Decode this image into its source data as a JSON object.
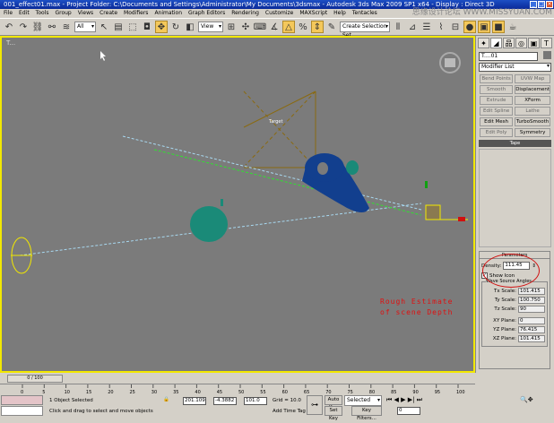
{
  "title": "001_effect01.max    -    Project Folder: C:\\Documents and Settings\\Administrator\\My Documents\\3dsmax    -    Autodesk 3ds Max  2009 SP1  x64    -    Display : Direct 3D",
  "watermark": "思缘设计论坛 WWW.MISSYUAN.COM",
  "menu": [
    "File",
    "Edit",
    "Tools",
    "Group",
    "Views",
    "Create",
    "Modifiers",
    "Animation",
    "Graph Editors",
    "Rendering",
    "Customize",
    "MAXScript",
    "Help",
    "Tentacles"
  ],
  "toolbar": {
    "selection_filter": "All",
    "reference_coord": "View",
    "named_selection": "Create Selection Set"
  },
  "viewport": {
    "label": "T...",
    "annotation_line1": "Rough Estimate",
    "annotation_line2": "of scene Depth",
    "target_label": "Target",
    "colors": {
      "background": "#7b7b7b",
      "border": "#f2e800",
      "annotation": "#e01010",
      "mesh": "#123f8e",
      "teapot": "#1a8a78"
    }
  },
  "command_panel": {
    "tabs": [
      "create",
      "modify",
      "hierarchy",
      "motion",
      "display",
      "utilities"
    ],
    "object_name": "T....01",
    "modifier_list": "Modifier List",
    "buttons": [
      "Bend Points",
      "UVW Map",
      "Smooth",
      "Displacement",
      "Extrude",
      "XForm",
      "Edit Spline",
      "Lathe",
      "Edit Mesh",
      "TurboSmooth",
      "Edit Poly",
      "Symmetry"
    ],
    "stack_item": "Tape",
    "rollout_title": "Parameters",
    "density_label": "Density:",
    "density_value": "111.45",
    "show_icon_label": "Show Icon",
    "show_icon_checked": true,
    "group_title": "Wave Source Angles",
    "fields": [
      {
        "label": "Tx Scale:",
        "value": "101.415"
      },
      {
        "label": "Ty Scale:",
        "value": "100.750"
      },
      {
        "label": "Tz Scale:",
        "value": "90"
      },
      {
        "label": "XY Plane:",
        "value": "0"
      },
      {
        "label": "YZ Plane:",
        "value": "76.415"
      },
      {
        "label": "XZ Plane:",
        "value": "101.415"
      }
    ]
  },
  "timeline": {
    "slider": "0 / 100",
    "ticks": [
      "0",
      "5",
      "10",
      "15",
      "20",
      "25",
      "30",
      "35",
      "40",
      "45",
      "50",
      "55",
      "60",
      "65",
      "70",
      "75",
      "80",
      "85",
      "90",
      "95",
      "100"
    ]
  },
  "status": {
    "selection": "1 Object Selected",
    "prompt": "Click and drag to select and move objects",
    "x": "201.109",
    "y": "-4.3882",
    "z": "101.0",
    "grid": "Grid = 10.0",
    "add_time_tag": "Add Time Tag",
    "auto_key": "Auto Key",
    "selected": "Selected",
    "set_key": "Set Key",
    "key_filters": "Key Filters...",
    "frame": "0"
  }
}
